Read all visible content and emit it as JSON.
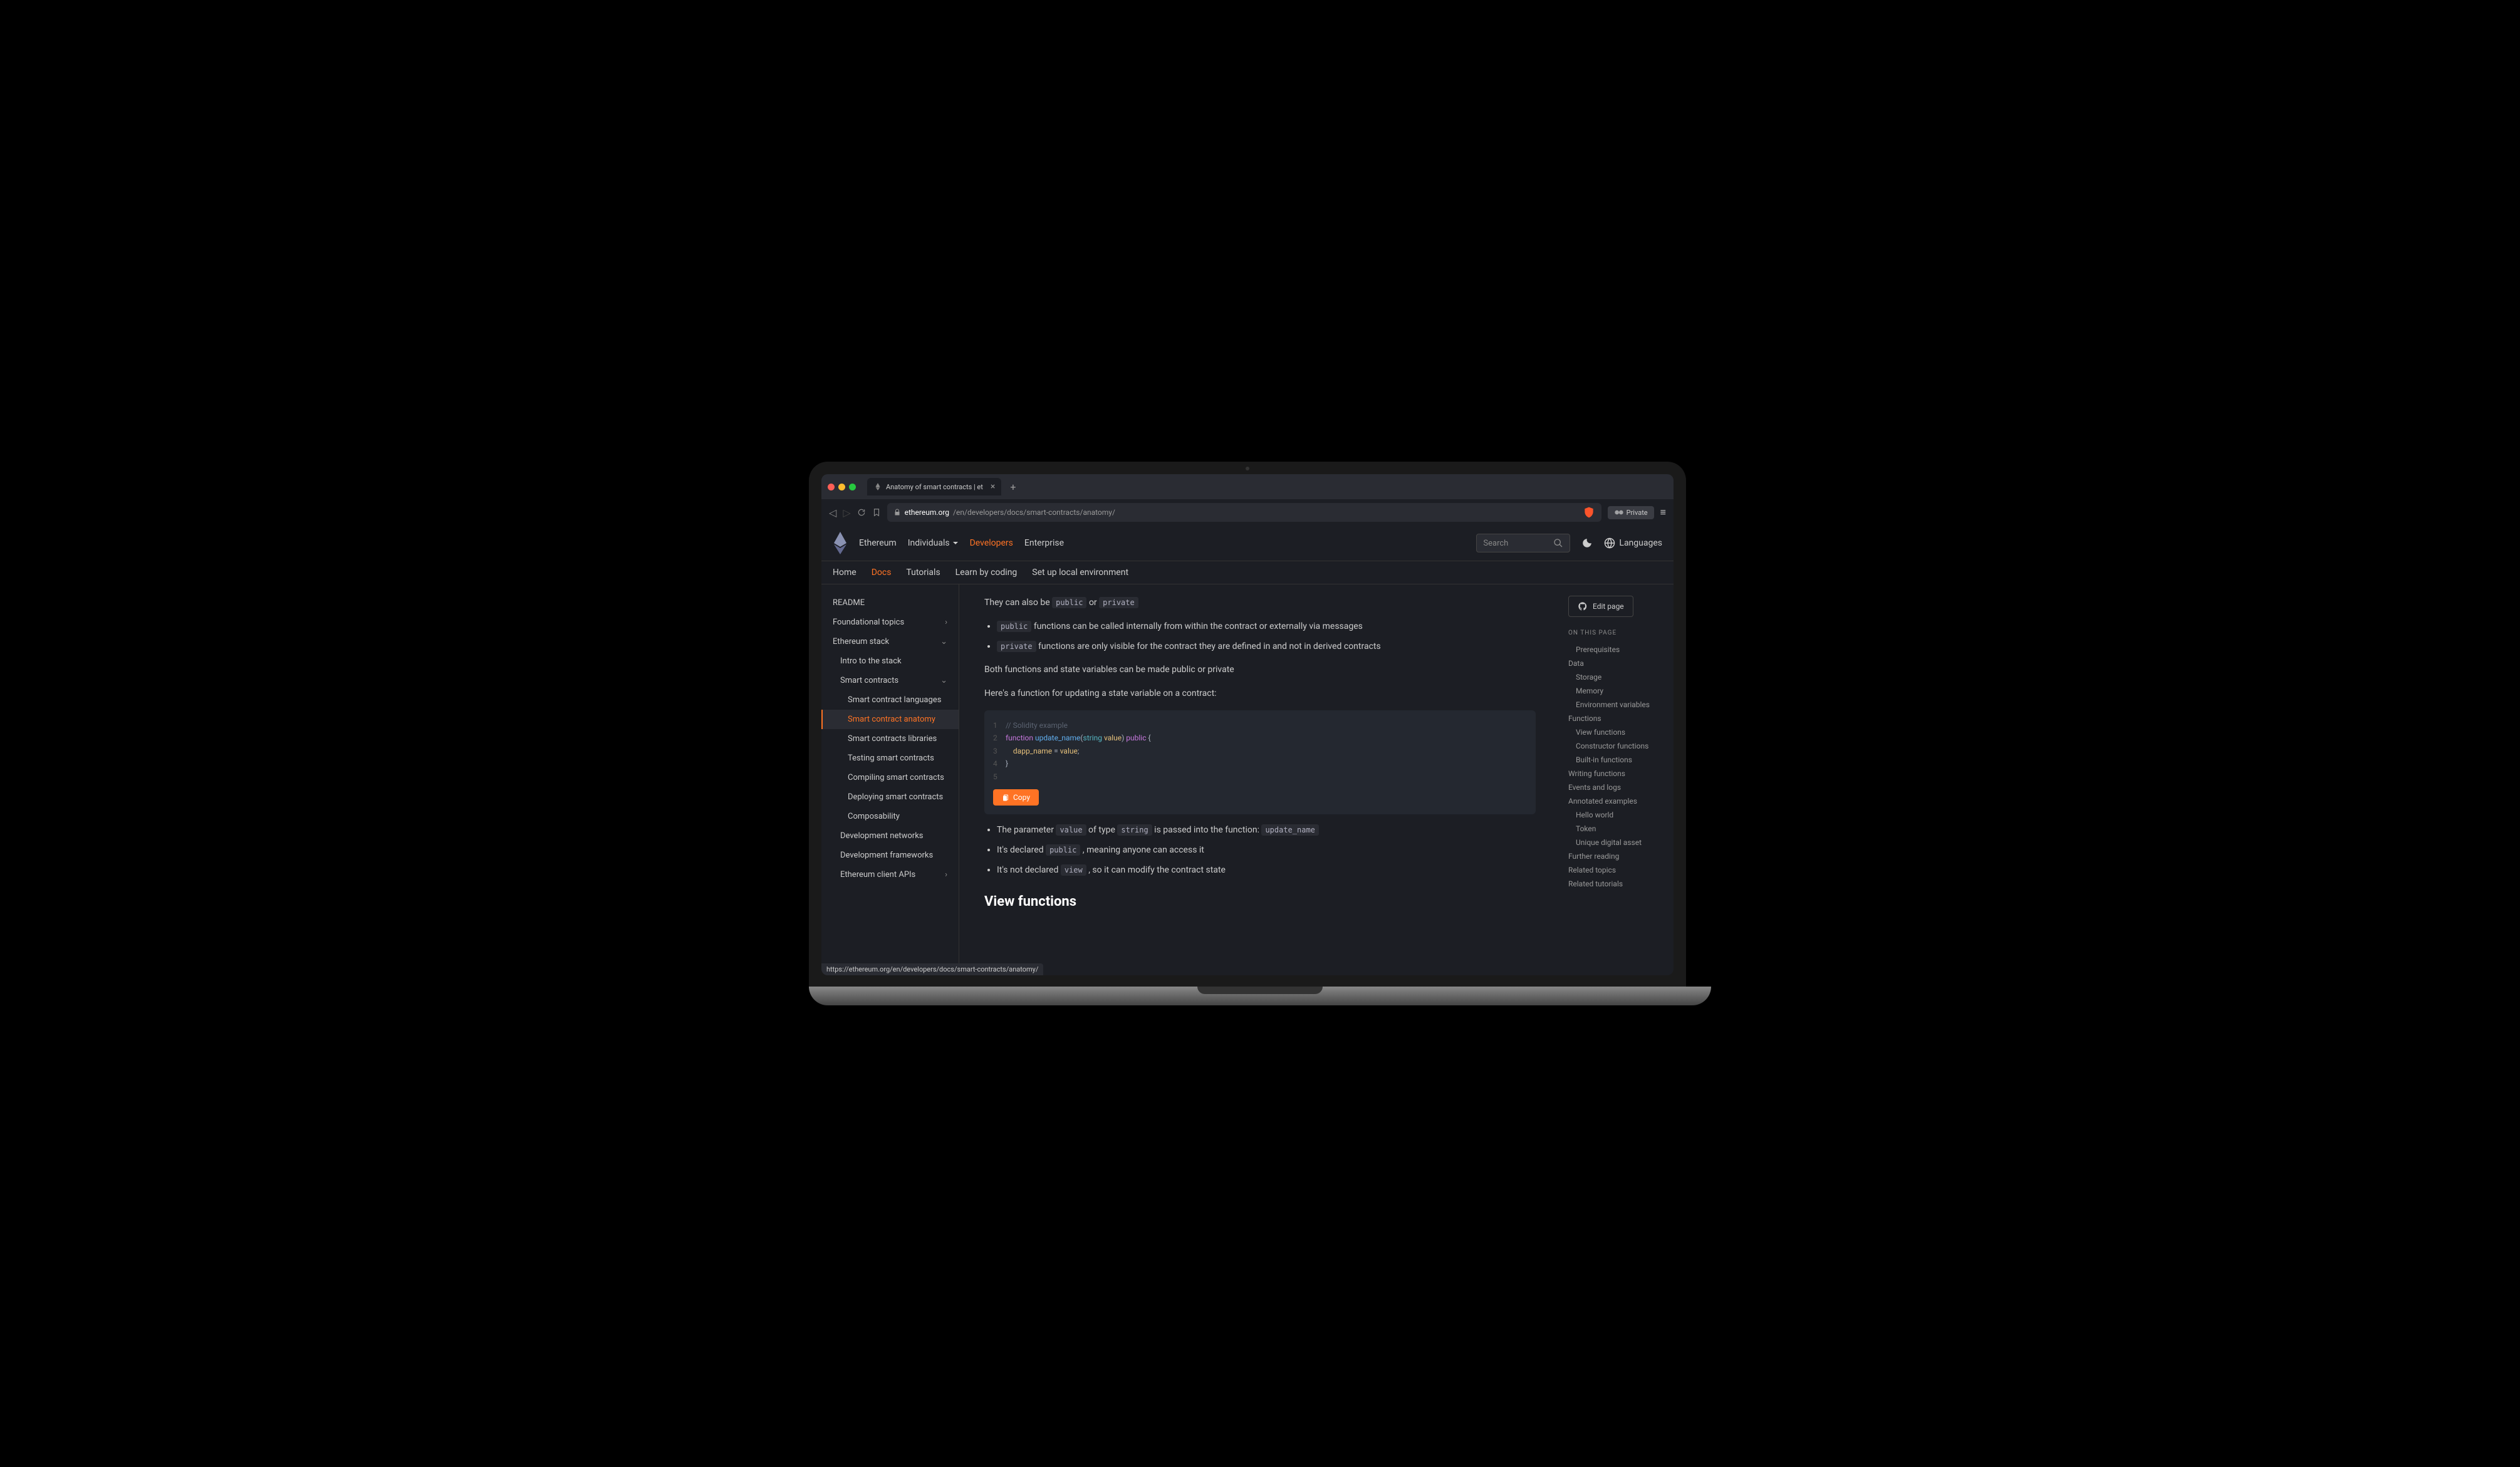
{
  "browser": {
    "tab_title": "Anatomy of smart contracts | et",
    "url_host": "ethereum.org",
    "url_path": "/en/developers/docs/smart-contracts/anatomy/",
    "private_label": "Private",
    "status_url": "https://ethereum.org/en/developers/docs/smart-contracts/anatomy/"
  },
  "header": {
    "brand": "Ethereum",
    "nav": [
      "Individuals",
      "Developers",
      "Enterprise"
    ],
    "search_placeholder": "Search",
    "languages": "Languages"
  },
  "subnav": [
    "Home",
    "Docs",
    "Tutorials",
    "Learn by coding",
    "Set up local environment"
  ],
  "sidebar": {
    "items": [
      {
        "label": "README",
        "indent": 0
      },
      {
        "label": "Foundational topics",
        "indent": 0,
        "chevron": "right"
      },
      {
        "label": "Ethereum stack",
        "indent": 0,
        "chevron": "down"
      },
      {
        "label": "Intro to the stack",
        "indent": 1
      },
      {
        "label": "Smart contracts",
        "indent": 1,
        "chevron": "down"
      },
      {
        "label": "Smart contract languages",
        "indent": 2
      },
      {
        "label": "Smart contract anatomy",
        "indent": 2,
        "active": true
      },
      {
        "label": "Smart contracts libraries",
        "indent": 2
      },
      {
        "label": "Testing smart contracts",
        "indent": 2
      },
      {
        "label": "Compiling smart contracts",
        "indent": 2
      },
      {
        "label": "Deploying smart contracts",
        "indent": 2
      },
      {
        "label": "Composability",
        "indent": 2
      },
      {
        "label": "Development networks",
        "indent": 1
      },
      {
        "label": "Development frameworks",
        "indent": 1
      },
      {
        "label": "Ethereum client APIs",
        "indent": 1,
        "chevron": "right"
      }
    ]
  },
  "content": {
    "p1_pre": "They can also be ",
    "p1_code1": "public",
    "p1_mid": " or ",
    "p1_code2": "private",
    "li1_code": "public",
    "li1_text": " functions can be called internally from within the contract or externally via messages",
    "li2_code": "private",
    "li2_text": " functions are only visible for the contract they are defined in and not in derived contracts",
    "p2": "Both functions and state variables can be made public or private",
    "p3": "Here's a function for updating a state variable on a contract:",
    "code": {
      "l1": "// Solidity example",
      "l2_kw": "function",
      "l2_name": "update_name",
      "l2_type": "string",
      "l2_param": "value",
      "l2_mod": "public",
      "l3_var": "dapp_name",
      "l3_val": "value"
    },
    "copy": "Copy",
    "li3_pre": "The parameter ",
    "li3_c1": "value",
    "li3_mid1": " of type ",
    "li3_c2": "string",
    "li3_mid2": " is passed into the function: ",
    "li3_c3": "update_name",
    "li4_pre": "It's declared ",
    "li4_c1": "public",
    "li4_post": " , meaning anyone can access it",
    "li5_pre": "It's not declared ",
    "li5_c1": "view",
    "li5_post": " , so it can modify the contract state",
    "h2": "View functions"
  },
  "rightbar": {
    "edit": "Edit page",
    "toc_title": "ON THIS PAGE",
    "toc": [
      {
        "label": "Prerequisites",
        "indent": 1
      },
      {
        "label": "Data",
        "indent": 0
      },
      {
        "label": "Storage",
        "indent": 1
      },
      {
        "label": "Memory",
        "indent": 1
      },
      {
        "label": "Environment variables",
        "indent": 1
      },
      {
        "label": "Functions",
        "indent": 0
      },
      {
        "label": "View functions",
        "indent": 1
      },
      {
        "label": "Constructor functions",
        "indent": 1
      },
      {
        "label": "Built-in functions",
        "indent": 1
      },
      {
        "label": "Writing functions",
        "indent": 0
      },
      {
        "label": "Events and logs",
        "indent": 0
      },
      {
        "label": "Annotated examples",
        "indent": 0
      },
      {
        "label": "Hello world",
        "indent": 1
      },
      {
        "label": "Token",
        "indent": 1
      },
      {
        "label": "Unique digital asset",
        "indent": 1
      },
      {
        "label": "Further reading",
        "indent": 0
      },
      {
        "label": "Related topics",
        "indent": 0
      },
      {
        "label": "Related tutorials",
        "indent": 0
      }
    ]
  }
}
